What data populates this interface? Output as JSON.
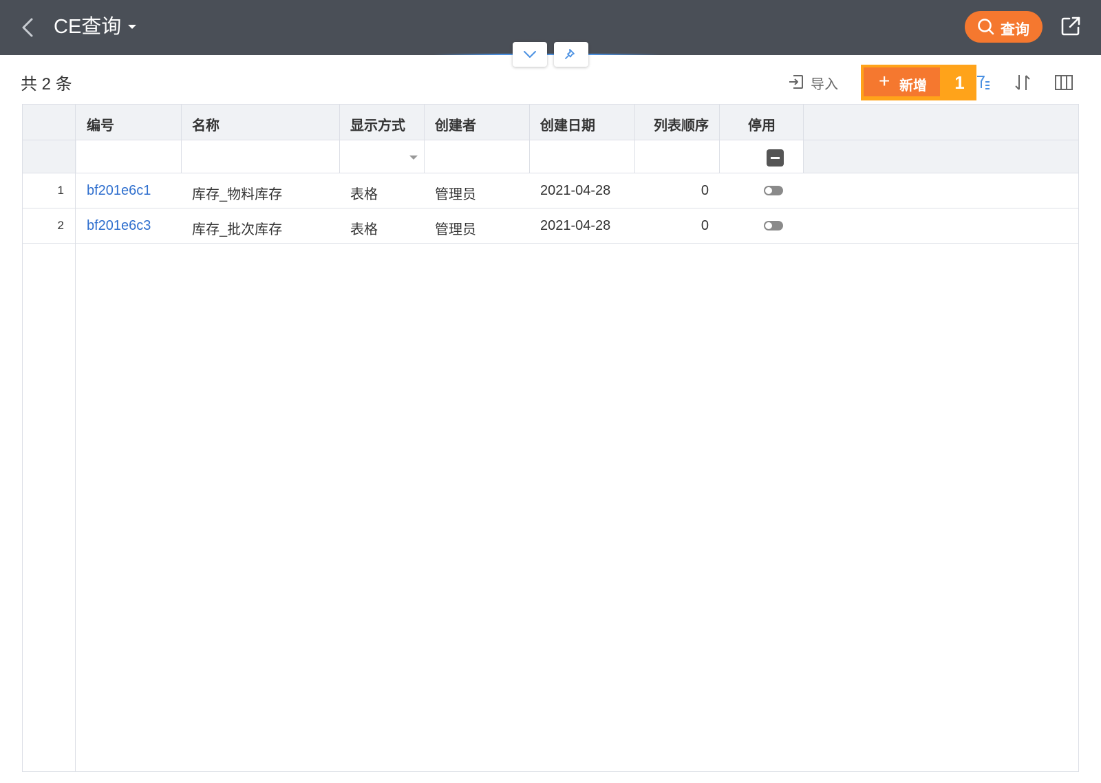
{
  "header": {
    "title": "CE查询",
    "query_label": "查询"
  },
  "toolbar": {
    "count_label": "共 2 条",
    "import_label": "导入",
    "new_label": "新增",
    "step_badge": "1"
  },
  "table": {
    "columns": [
      "编号",
      "名称",
      "显示方式",
      "创建者",
      "创建日期",
      "列表顺序",
      "停用"
    ],
    "rows": [
      {
        "index": "1",
        "code": "bf201e6c1",
        "name": "库存_物料库存",
        "display": "表格",
        "creator": "管理员",
        "date": "2021-04-28",
        "order": "0",
        "disabled": false
      },
      {
        "index": "2",
        "code": "bf201e6c3",
        "name": "库存_批次库存",
        "display": "表格",
        "creator": "管理员",
        "date": "2021-04-28",
        "order": "0",
        "disabled": false
      }
    ]
  },
  "colors": {
    "topbar": "#4a4f57",
    "accent": "#f5782f",
    "highlight": "#ffa31a",
    "link": "#2f6fce"
  },
  "icons": [
    "back-arrow-icon",
    "caret-down-icon",
    "search-icon",
    "share-icon",
    "chevron-down-icon",
    "pin-icon",
    "import-icon",
    "plus-icon",
    "filter-icon",
    "sort-icon",
    "columns-icon"
  ]
}
